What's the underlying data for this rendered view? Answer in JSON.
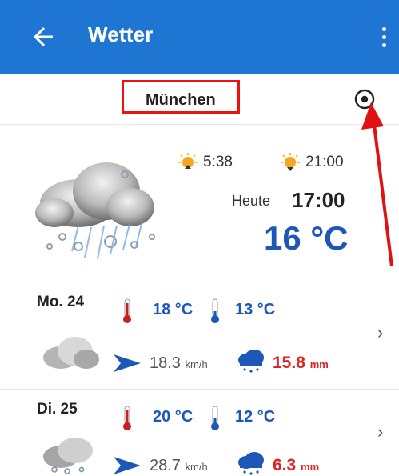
{
  "app": {
    "title": "Wetter"
  },
  "location": {
    "city": "München"
  },
  "today": {
    "sunrise": "5:38",
    "sunset": "21:00",
    "label": "Heute",
    "time": "17:00",
    "temperature": "16 °C",
    "condition_icon": "heavy-rain-cloud-icon"
  },
  "forecast": [
    {
      "date": "Mo. 24",
      "max": "18 °C",
      "min": "13 °C",
      "wind_value": "18.3",
      "wind_unit": "km/h",
      "rain_value": "15.8",
      "rain_unit": "mm"
    },
    {
      "date": "Di. 25",
      "max": "20 °C",
      "min": "12 °C",
      "wind_value": "28.7",
      "wind_unit": "km/h",
      "rain_value": "6.3",
      "rain_unit": "mm"
    }
  ],
  "colors": {
    "appbar": "#1e76d2",
    "temp_blue": "#1d57b8",
    "rain_red": "#d22222",
    "annotation_red": "#e11111"
  }
}
